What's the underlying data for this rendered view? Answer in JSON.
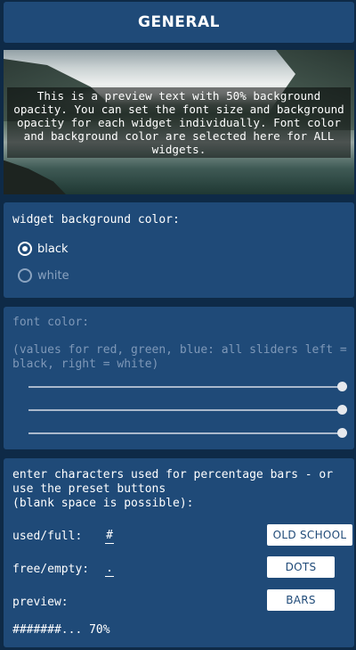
{
  "header": {
    "title": "GENERAL"
  },
  "preview": {
    "text": "This is a preview text with 50% background opacity. You can set the font size and background opacity for each widget individually. Font color and background color are selected here for ALL widgets."
  },
  "background_color": {
    "title": "widget background color:",
    "options": [
      {
        "label": "black",
        "selected": true
      },
      {
        "label": "white",
        "selected": false
      }
    ]
  },
  "font_color": {
    "title": "font color:",
    "hint": "(values for red, green, blue: all sliders left = black, right = white)",
    "sliders": [
      {
        "name": "red",
        "value": 1.0
      },
      {
        "name": "green",
        "value": 1.0
      },
      {
        "name": "blue",
        "value": 1.0
      }
    ]
  },
  "percentage_bars": {
    "intro": "enter characters used for percentage bars - or use the preset buttons\n(blank space is possible):",
    "used_label": "used/full:",
    "used_value": "#",
    "free_label": "free/empty:",
    "free_value": ".",
    "preview_label": "preview:",
    "preview_value": "#######... 70%",
    "buttons": {
      "old_school": "OLD SCHOOL",
      "dots": "DOTS",
      "bars": "BARS"
    }
  },
  "colors": {
    "page_background": "#0e2a47",
    "card_background": "#1f4a78",
    "text": "#ffffff",
    "dim_text": "#7e98b8",
    "button_background": "#ffffff",
    "button_text": "#1f4a78"
  }
}
